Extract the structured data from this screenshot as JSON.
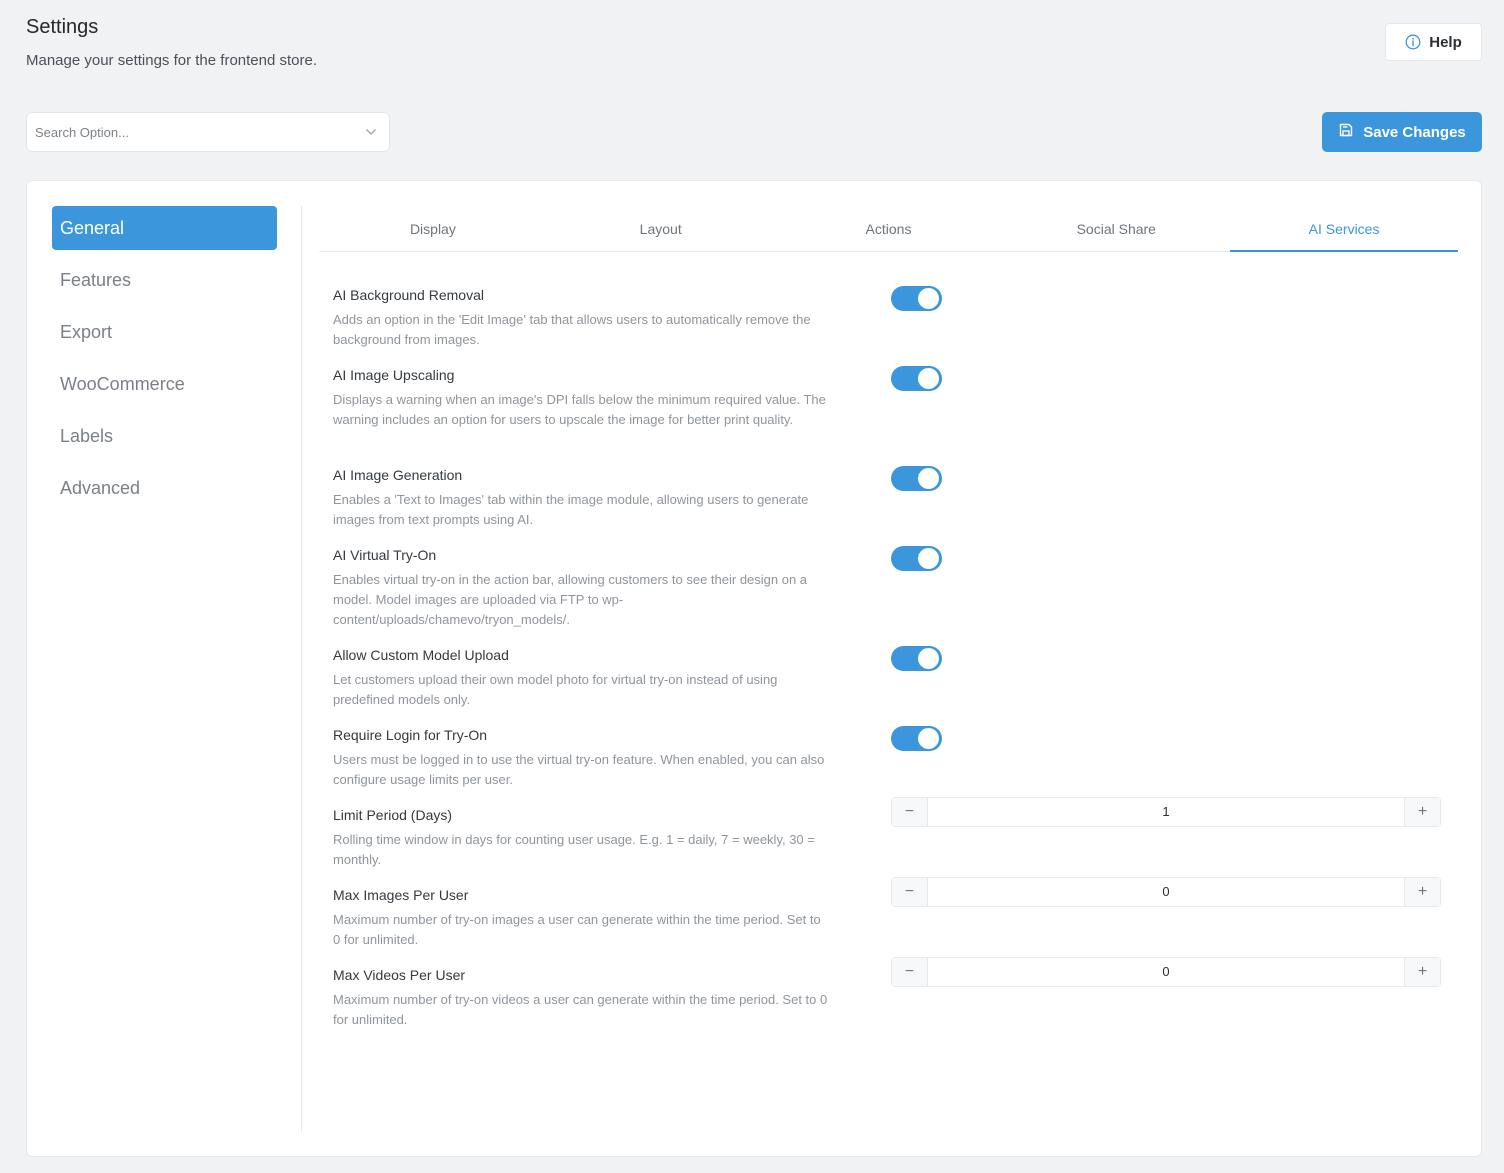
{
  "header": {
    "title": "Settings",
    "subtitle": "Manage your settings for the frontend store.",
    "help_label": "Help"
  },
  "search": {
    "placeholder": "Search Option..."
  },
  "save_label": "Save Changes",
  "sidebar": {
    "items": [
      {
        "label": "General",
        "active": true
      },
      {
        "label": "Features"
      },
      {
        "label": "Export"
      },
      {
        "label": "WooCommerce"
      },
      {
        "label": "Labels"
      },
      {
        "label": "Advanced"
      }
    ]
  },
  "tabs": [
    {
      "label": "Display"
    },
    {
      "label": "Layout"
    },
    {
      "label": "Actions"
    },
    {
      "label": "Social Share"
    },
    {
      "label": "AI Services",
      "active": true
    }
  ],
  "settings": [
    {
      "title": "AI Background Removal",
      "desc": "Adds an option in the 'Edit Image' tab that allows users to automatically remove the background from images.",
      "control": "toggle",
      "enabled": true
    },
    {
      "title": "AI Image Upscaling",
      "desc": "Displays a warning when an image's DPI falls below the minimum required value. The warning includes an option for users to upscale the image for better print quality.",
      "control": "toggle",
      "enabled": true
    },
    {
      "title": "AI Image Generation",
      "desc": "Enables a 'Text to Images' tab within the image module, allowing users to generate images from text prompts using AI.",
      "control": "toggle",
      "enabled": true
    },
    {
      "title": "AI Virtual Try-On",
      "desc": "Enables virtual try-on in the action bar, allowing customers to see their design on a model. Model images are uploaded via FTP to wp-content/uploads/chamevo/tryon_models/.",
      "control": "toggle",
      "enabled": true
    },
    {
      "title": "Allow Custom Model Upload",
      "desc": "Let customers upload their own model photo for virtual try-on instead of using predefined models only.",
      "control": "toggle",
      "enabled": true
    },
    {
      "title": "Require Login for Try-On",
      "desc": "Users must be logged in to use the virtual try-on feature. When enabled, you can also configure usage limits per user.",
      "control": "toggle",
      "enabled": true
    },
    {
      "title": "Limit Period (Days)",
      "desc": "Rolling time window in days for counting user usage. E.g. 1 = daily, 7 = weekly, 30 = monthly.",
      "control": "stepper",
      "value": "1"
    },
    {
      "title": "Max Images Per User",
      "desc": "Maximum number of try-on images a user can generate within the time period. Set to 0 for unlimited.",
      "control": "stepper",
      "value": "0"
    },
    {
      "title": "Max Videos Per User",
      "desc": "Maximum number of try-on videos a user can generate within the time period. Set to 0 for unlimited.",
      "control": "stepper",
      "value": "0"
    }
  ],
  "stepper_symbols": {
    "minus": "−",
    "plus": "+"
  },
  "colors": {
    "accent": "#3b96dc",
    "background": "#f1f2f4"
  }
}
